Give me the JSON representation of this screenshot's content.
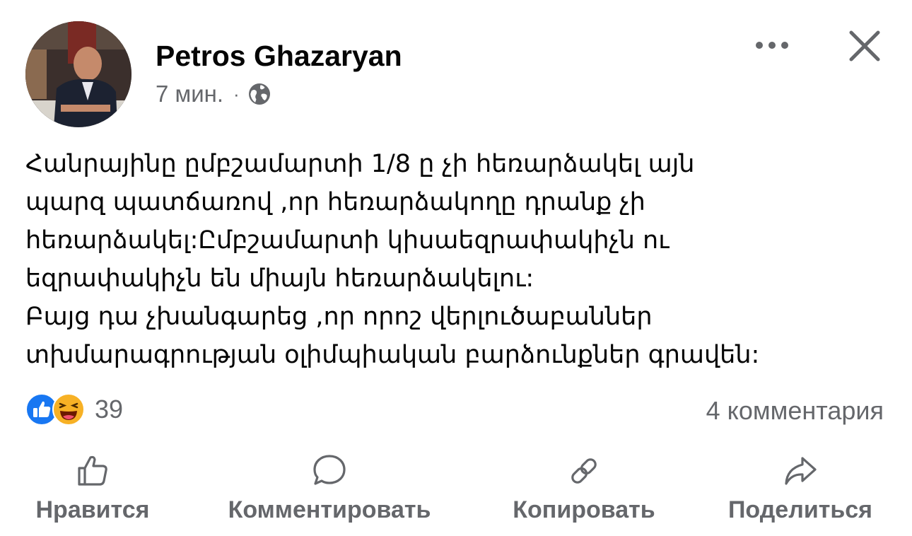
{
  "post": {
    "author": "Petros Ghazaryan",
    "time": "7 мин.",
    "separator": "·",
    "audience_icon": "globe-icon",
    "text_lines": [
      "Հանրայինը ըմբշամարտի 1/8 ը չի հեռարձակել այն",
      "պարզ պատճառով ,որ հեռարձակողը դրանք չի",
      "հեռարձակել:Ըմբշամարտի կիսաեզրափակիչն ու",
      "եզրափակիչն են միայն հեռարձակելու:",
      "Բայց դա չխանգարեց ,որ որոշ վերլուծաբաններ",
      "տխմարագրության օլիմպիական բարձունքներ գրավեն:"
    ]
  },
  "header_buttons": {
    "more_icon": "more-horizontal-icon",
    "close_icon": "close-icon"
  },
  "reactions": {
    "icons": [
      "like-reaction-icon",
      "haha-reaction-icon"
    ],
    "count": "39",
    "comments": "4 комментария"
  },
  "actions": [
    {
      "icon": "thumbs-up-icon",
      "label": "Нравится"
    },
    {
      "icon": "comment-icon",
      "label": "Комментировать"
    },
    {
      "icon": "link-icon",
      "label": "Копировать"
    },
    {
      "icon": "share-icon",
      "label": "Поделиться"
    }
  ],
  "colors": {
    "text_primary": "#050505",
    "text_secondary": "#65676b",
    "like_blue": "#1877f2",
    "haha_yellow": "#f7b125"
  }
}
